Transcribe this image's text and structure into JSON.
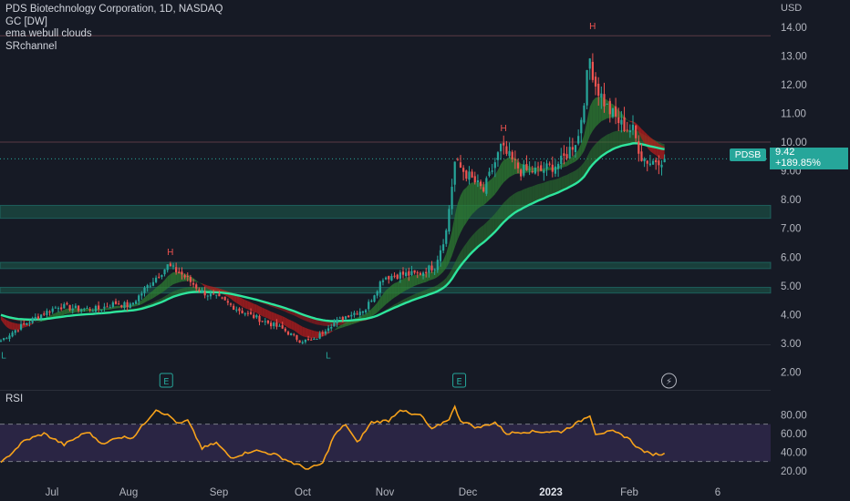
{
  "legend": {
    "symbol_line": "PDS Biotechnology Corporation, 1D, NASDAQ",
    "indicator_1": "GC [DW]",
    "indicator_2": "ema webull clouds",
    "indicator_3": "SRchannel"
  },
  "ticker": "PDSB",
  "last_price": "9.42",
  "change_pct": "+189.85%",
  "currency": "USD",
  "rsi_label": "RSI",
  "colors": {
    "up": "#26a69a",
    "down": "#ef5350",
    "rsi": "#f7a21b",
    "cloud_green": "#2e7d32",
    "cloud_red": "#b71c1c",
    "ema_line": "#2ee59d",
    "background": "#161a25"
  },
  "chart_data": [
    {
      "type": "candlestick",
      "title": "PDS Biotechnology Corporation, 1D, NASDAQ",
      "y_axis_label": "USD",
      "ylim": [
        1.7,
        14.5
      ],
      "y_ticks": [
        2.0,
        3.0,
        4.0,
        5.0,
        6.0,
        7.0,
        8.0,
        9.0,
        10.0,
        11.0,
        12.0,
        13.0,
        14.0
      ],
      "y_tick_labels": [
        "2.00",
        "3.00",
        "4.00",
        "5.00",
        "6.00",
        "7.00",
        "8.00",
        "9.00",
        "10.00",
        "11.00",
        "12.00",
        "13.00",
        "14.00"
      ],
      "x_tick_labels": [
        "Jul",
        "Aug",
        "Sep",
        "Oct",
        "Nov",
        "Dec",
        "2023",
        "Feb",
        "6"
      ],
      "close_path": [
        {
          "bar": 0,
          "close": 3.1
        },
        {
          "bar": 7,
          "close": 3.6
        },
        {
          "bar": 14,
          "close": 4.0
        },
        {
          "bar": 20,
          "close": 4.3
        },
        {
          "bar": 27,
          "close": 4.2
        },
        {
          "bar": 34,
          "close": 4.2
        },
        {
          "bar": 40,
          "close": 4.4
        },
        {
          "bar": 45,
          "close": 4.3
        },
        {
          "bar": 52,
          "close": 5.1
        },
        {
          "bar": 58,
          "close": 5.7
        },
        {
          "bar": 63,
          "close": 5.4
        },
        {
          "bar": 70,
          "close": 4.8
        },
        {
          "bar": 77,
          "close": 4.5
        },
        {
          "bar": 84,
          "close": 4.1
        },
        {
          "bar": 91,
          "close": 3.8
        },
        {
          "bar": 98,
          "close": 3.5
        },
        {
          "bar": 104,
          "close": 3.1
        },
        {
          "bar": 109,
          "close": 3.1
        },
        {
          "bar": 114,
          "close": 3.6
        },
        {
          "bar": 121,
          "close": 4.0
        },
        {
          "bar": 127,
          "close": 4.2
        },
        {
          "bar": 133,
          "close": 5.3
        },
        {
          "bar": 139,
          "close": 5.4
        },
        {
          "bar": 145,
          "close": 5.4
        },
        {
          "bar": 151,
          "close": 5.7
        },
        {
          "bar": 155,
          "close": 6.9
        },
        {
          "bar": 158,
          "close": 9.3
        },
        {
          "bar": 163,
          "close": 8.8
        },
        {
          "bar": 168,
          "close": 8.3
        },
        {
          "bar": 174,
          "close": 9.8
        },
        {
          "bar": 181,
          "close": 9.0
        },
        {
          "bar": 188,
          "close": 9.0
        },
        {
          "bar": 195,
          "close": 9.3
        },
        {
          "bar": 201,
          "close": 10.2
        },
        {
          "bar": 205,
          "close": 12.9
        },
        {
          "bar": 207,
          "close": 12.0
        },
        {
          "bar": 211,
          "close": 11.2
        },
        {
          "bar": 216,
          "close": 10.6
        },
        {
          "bar": 220,
          "close": 10.4
        },
        {
          "bar": 223,
          "close": 9.5
        },
        {
          "bar": 226,
          "close": 9.3
        },
        {
          "bar": 229,
          "close": 9.42
        }
      ],
      "sr_channels": [
        [
          4.75,
          4.95
        ],
        [
          5.6,
          5.82
        ],
        [
          7.35,
          7.8
        ]
      ],
      "horizontal_lines": [
        13.7,
        10.0
      ],
      "pivot_labels": [
        {
          "text": "H",
          "bar": 58,
          "price": 5.95,
          "pos": "above"
        },
        {
          "text": "H",
          "bar": 174,
          "price": 10.25,
          "pos": "above"
        },
        {
          "text": "H",
          "bar": 205,
          "price": 13.8,
          "pos": "above"
        },
        {
          "text": "L",
          "bar": 0,
          "price": 2.85,
          "pos": "below"
        },
        {
          "text": "L",
          "bar": 113,
          "price": 2.85,
          "pos": "below"
        }
      ],
      "event_markers": [
        {
          "text": "E",
          "bar": 55
        },
        {
          "text": "E",
          "bar": 157
        },
        {
          "text": "⚡",
          "bar": 230
        }
      ]
    },
    {
      "type": "line",
      "name": "RSI",
      "ylim": [
        17,
        97
      ],
      "y_ticks": [
        20,
        40,
        60,
        80
      ],
      "y_tick_labels": [
        "20.00",
        "40.00",
        "60.00",
        "80.00"
      ],
      "band": [
        30,
        70
      ],
      "values_path": [
        {
          "bar": 0,
          "v": 28
        },
        {
          "bar": 8,
          "v": 52
        },
        {
          "bar": 15,
          "v": 60
        },
        {
          "bar": 22,
          "v": 48
        },
        {
          "bar": 30,
          "v": 62
        },
        {
          "bar": 36,
          "v": 48
        },
        {
          "bar": 40,
          "v": 56
        },
        {
          "bar": 46,
          "v": 56
        },
        {
          "bar": 54,
          "v": 86
        },
        {
          "bar": 59,
          "v": 78
        },
        {
          "bar": 62,
          "v": 70
        },
        {
          "bar": 65,
          "v": 74
        },
        {
          "bar": 70,
          "v": 44
        },
        {
          "bar": 75,
          "v": 50
        },
        {
          "bar": 80,
          "v": 34
        },
        {
          "bar": 88,
          "v": 42
        },
        {
          "bar": 95,
          "v": 38
        },
        {
          "bar": 102,
          "v": 28
        },
        {
          "bar": 107,
          "v": 22
        },
        {
          "bar": 112,
          "v": 28
        },
        {
          "bar": 116,
          "v": 58
        },
        {
          "bar": 120,
          "v": 70
        },
        {
          "bar": 124,
          "v": 50
        },
        {
          "bar": 129,
          "v": 72
        },
        {
          "bar": 135,
          "v": 74
        },
        {
          "bar": 139,
          "v": 86
        },
        {
          "bar": 143,
          "v": 80
        },
        {
          "bar": 146,
          "v": 80
        },
        {
          "bar": 150,
          "v": 64
        },
        {
          "bar": 156,
          "v": 76
        },
        {
          "bar": 158,
          "v": 88
        },
        {
          "bar": 160,
          "v": 74
        },
        {
          "bar": 166,
          "v": 66
        },
        {
          "bar": 172,
          "v": 72
        },
        {
          "bar": 176,
          "v": 60
        },
        {
          "bar": 182,
          "v": 62
        },
        {
          "bar": 188,
          "v": 62
        },
        {
          "bar": 195,
          "v": 62
        },
        {
          "bar": 201,
          "v": 72
        },
        {
          "bar": 205,
          "v": 80
        },
        {
          "bar": 207,
          "v": 60
        },
        {
          "bar": 213,
          "v": 62
        },
        {
          "bar": 218,
          "v": 56
        },
        {
          "bar": 222,
          "v": 44
        },
        {
          "bar": 226,
          "v": 38
        },
        {
          "bar": 231,
          "v": 38
        }
      ]
    }
  ]
}
